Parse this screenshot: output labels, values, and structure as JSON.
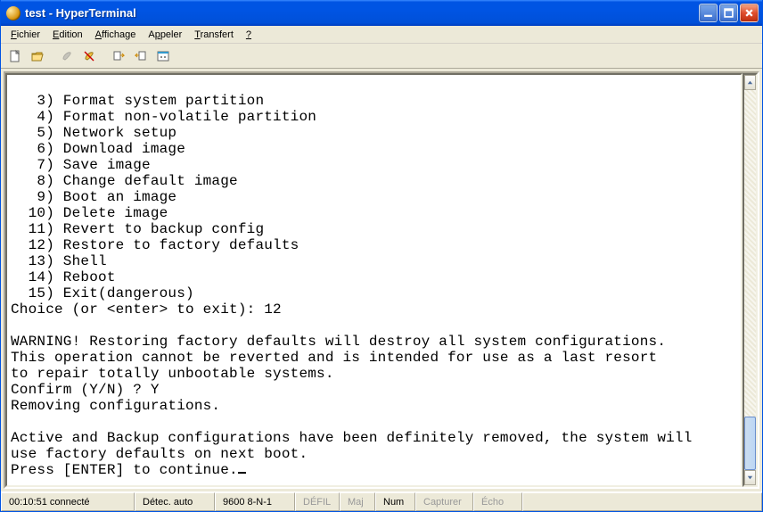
{
  "window": {
    "title": "test - HyperTerminal"
  },
  "menu": {
    "fichier": "Fichier",
    "edition": "Edition",
    "affichage": "Affichage",
    "appeler": "Appeler",
    "transfert": "Transfert",
    "aide": "?"
  },
  "toolbar": {
    "new": "new-doc",
    "open": "open-folder",
    "connect": "phone-connect",
    "disconnect": "phone-disconnect",
    "send": "send-file",
    "receive": "receive-file",
    "properties": "properties"
  },
  "terminal": {
    "lines": [
      "",
      "   3) Format system partition",
      "   4) Format non-volatile partition",
      "   5) Network setup",
      "   6) Download image",
      "   7) Save image",
      "   8) Change default image",
      "   9) Boot an image",
      "  10) Delete image",
      "  11) Revert to backup config",
      "  12) Restore to factory defaults",
      "  13) Shell",
      "  14) Reboot",
      "  15) Exit(dangerous)",
      "Choice (or <enter> to exit): 12",
      "",
      "WARNING! Restoring factory defaults will destroy all system configurations.",
      "This operation cannot be reverted and is intended for use as a last resort",
      "to repair totally unbootable systems.",
      "Confirm (Y/N) ? Y",
      "Removing configurations.",
      "",
      "Active and Backup configurations have been definitely removed, the system will",
      "use factory defaults on next boot.",
      "Press [ENTER] to continue."
    ]
  },
  "status": {
    "time_connected": "00:10:51 connecté",
    "autodetect": "Détec. auto",
    "port_settings": "9600 8-N-1",
    "defil": "DÉFIL",
    "maj": "Maj",
    "num": "Num",
    "capturer": "Capturer",
    "echo": "Écho"
  }
}
